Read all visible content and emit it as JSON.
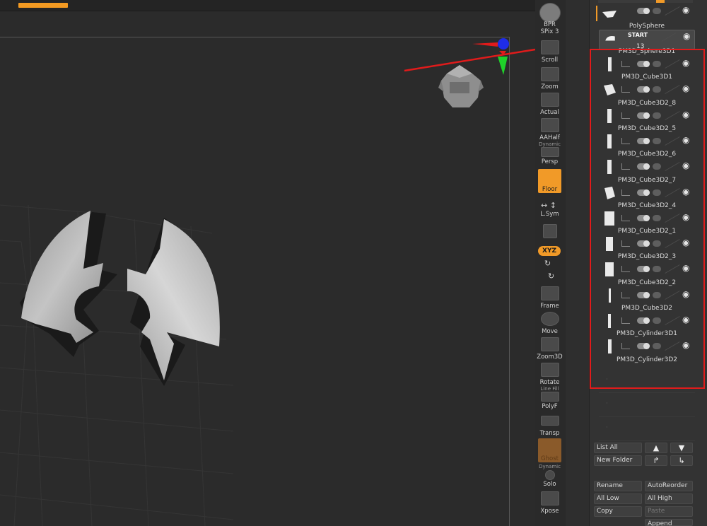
{
  "toolbar": {
    "bpr": "BPR",
    "spix": "SPix 3",
    "scroll": "Scroll",
    "zoom": "Zoom",
    "actual": "Actual",
    "aahalf": "AAHalf",
    "dynamic": "Dynamic",
    "persp": "Persp",
    "floor": "Floor",
    "lsym": "L.Sym",
    "xyz": "XYZ",
    "frame": "Frame",
    "move": "Move",
    "zoom3d": "Zoom3D",
    "rotate": "Rotate",
    "line_fill": "Line Fill",
    "polyf": "PolyF",
    "transp": "Transp",
    "ghost": "Ghost",
    "dynamic2": "Dynamic",
    "solo": "Solo",
    "xpose": "Xpose"
  },
  "subtool": {
    "top_item": "PolySphere",
    "start_label": "START",
    "count": "13",
    "items": [
      {
        "name": "PM3D_Sphere3D1"
      },
      {
        "name": "PM3D_Cube3D1"
      },
      {
        "name": "PM3D_Cube3D2_8"
      },
      {
        "name": "PM3D_Cube3D2_5"
      },
      {
        "name": "PM3D_Cube3D2_6"
      },
      {
        "name": "PM3D_Cube3D2_7"
      },
      {
        "name": "PM3D_Cube3D2_4"
      },
      {
        "name": "PM3D_Cube3D2_1"
      },
      {
        "name": "PM3D_Cube3D2_3"
      },
      {
        "name": "PM3D_Cube3D2_2"
      },
      {
        "name": "PM3D_Cube3D2"
      },
      {
        "name": "PM3D_Cylinder3D1"
      },
      {
        "name": "PM3D_Cylinder3D2"
      }
    ]
  },
  "list_buttons": {
    "list_all": "List All",
    "new_folder": "New Folder",
    "rename": "Rename",
    "auto_reorder": "AutoReorder",
    "all_low": "All Low",
    "all_high": "All High",
    "copy": "Copy",
    "paste": "Paste",
    "append": "Append"
  },
  "icons": {
    "eye": "eye-icon",
    "arrow_up": "arrow-up-icon",
    "arrow_down": "arrow-down-icon"
  },
  "colors": {
    "accent": "#f19a28",
    "annotation": "#e01b1b",
    "gizmo_x": "#e11b1b",
    "gizmo_y": "#1fd12a",
    "gizmo_z": "#1f2de8"
  }
}
